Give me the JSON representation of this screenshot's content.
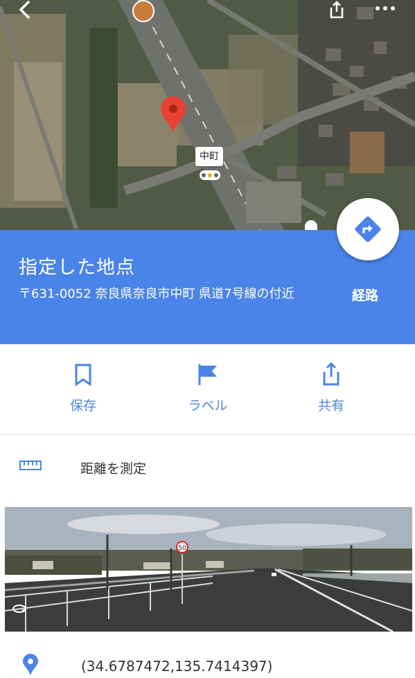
{
  "map": {
    "town_label": "中町",
    "icons": [
      "back-icon",
      "share-icon",
      "more-icon",
      "cafe-icon",
      "traffic-signal-icon",
      "location-pin-icon"
    ]
  },
  "place": {
    "title": "指定した地点",
    "address": "〒631-0052 奈良県奈良市中町 県道7号線の付近",
    "route_label": "経路"
  },
  "actions": [
    {
      "label": "保存",
      "icon": "bookmark-icon"
    },
    {
      "label": "ラベル",
      "icon": "flag-icon"
    },
    {
      "label": "共有",
      "icon": "share-icon"
    }
  ],
  "measure": {
    "label": "距離を測定",
    "icon": "ruler-icon"
  },
  "street_view": {
    "speed_sign": "50",
    "icon": "street-view-icon"
  },
  "coordinates": {
    "value": "(34.6787472,135.7414397)",
    "icon": "location-pin-icon"
  },
  "colors": {
    "accent": "#4a84e8",
    "pin": "#e94235"
  }
}
